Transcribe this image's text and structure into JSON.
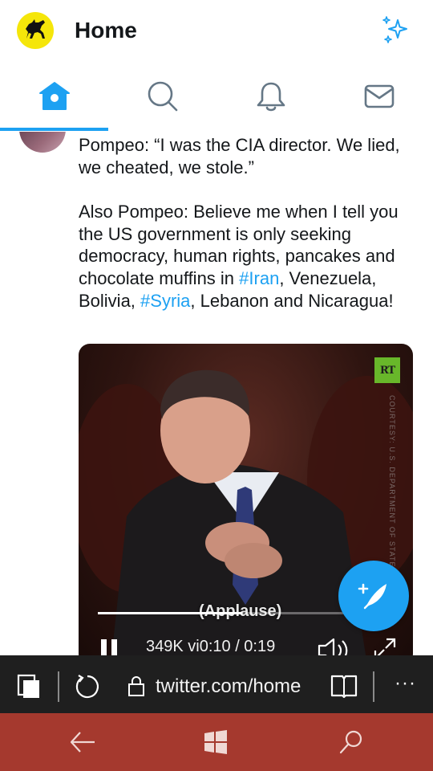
{
  "header": {
    "title": "Home"
  },
  "tabs": [
    {
      "name": "home",
      "icon": "home-icon",
      "active": true
    },
    {
      "name": "search",
      "icon": "search-icon",
      "active": false
    },
    {
      "name": "notifications",
      "icon": "bell-icon",
      "active": false
    },
    {
      "name": "messages",
      "icon": "mail-icon",
      "active": false
    }
  ],
  "tweet": {
    "line1": "Pompeo: “I was the CIA director. We lied, we cheated, we stole.”",
    "line2_before": "Also Pompeo: Believe me when I tell you the US government is only seeking democracy, human rights, pancakes and chocolate muffins in ",
    "hashtag1": "#Iran",
    "line2_mid": ", Venezuela, Bolivia, ",
    "hashtag2": "#Syria",
    "line2_after": ", Lebanon and Nicaragua!",
    "video": {
      "logo": "RT",
      "watermark": "COURTESY: U.S. DEPARTMENT OF STATE",
      "caption": "(Applause)",
      "progress": 0.53,
      "views_time": "349K vi0:10 / 0:19"
    }
  },
  "browser": {
    "url": "twitter.com/home"
  },
  "colors": {
    "accent": "#1da1f2",
    "browser_bar": "#1f1f1f",
    "nav_bar": "#a5392e"
  }
}
